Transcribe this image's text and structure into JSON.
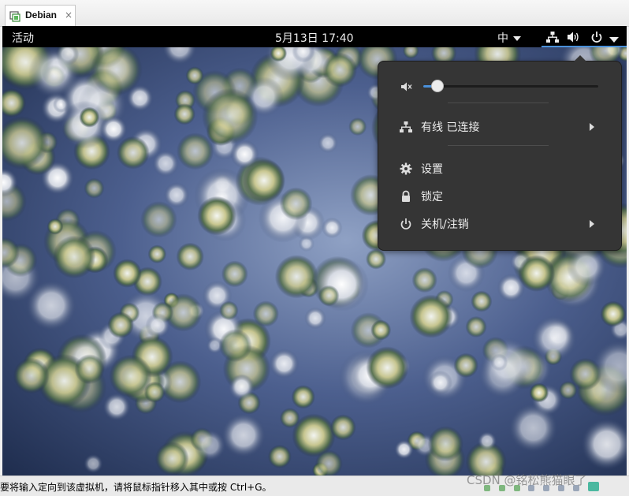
{
  "vm_tab": {
    "title": "Debian",
    "close_glyph": "×"
  },
  "topbar": {
    "activities": "活动",
    "clock": "5月13日  17:40",
    "input_method": "中",
    "icons": [
      "network-wired-icon",
      "volume-icon",
      "power-icon",
      "chevron-down-icon"
    ]
  },
  "popup": {
    "volume": {
      "level": 0.08
    },
    "items": [
      {
        "label": "有线 已连接",
        "icon": "network-wired-icon",
        "submenu": true
      },
      {
        "label": "设置",
        "icon": "settings-gear-icon",
        "submenu": false
      },
      {
        "label": "锁定",
        "icon": "lock-icon",
        "submenu": false
      },
      {
        "label": "关机/注销",
        "icon": "power-icon",
        "submenu": true
      }
    ]
  },
  "statusbar": {
    "message": "要将输入定向到该虚拟机，请将鼠标指针移入其中或按 Ctrl+G。",
    "watermark": "CSDN @铭松熊猫眼了"
  },
  "colors": {
    "accent": "#4a90d9",
    "popup_bg": "#353535",
    "topbar_bg": "#000000"
  }
}
